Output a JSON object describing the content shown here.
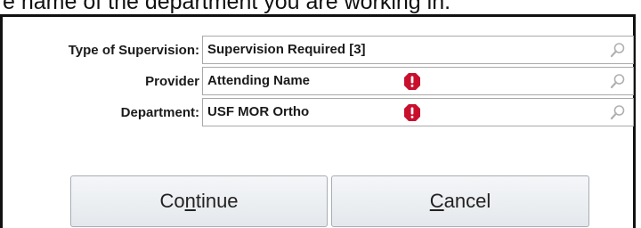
{
  "caption": {
    "text": "e name of the department you are working in."
  },
  "dialog": {
    "fields": [
      {
        "label": "Type of Supervision:",
        "value": "Supervision Required [3]",
        "icon": "search-icon",
        "required_alert": false
      },
      {
        "label": "Provider",
        "value": "Attending Name",
        "icon": "search-icon",
        "required_alert": true
      },
      {
        "label": "Department:",
        "value": "USF MOR Ortho",
        "icon": "search-icon",
        "required_alert": true
      }
    ],
    "buttons": {
      "continue": {
        "pre": "Co",
        "mnemonic": "n",
        "post": "tinue"
      },
      "cancel": {
        "pre": "",
        "mnemonic": "C",
        "post": "ancel"
      }
    }
  },
  "colors": {
    "alert": "#c8102e",
    "border": "#a9a9a9",
    "dialog_border": "#111111"
  }
}
